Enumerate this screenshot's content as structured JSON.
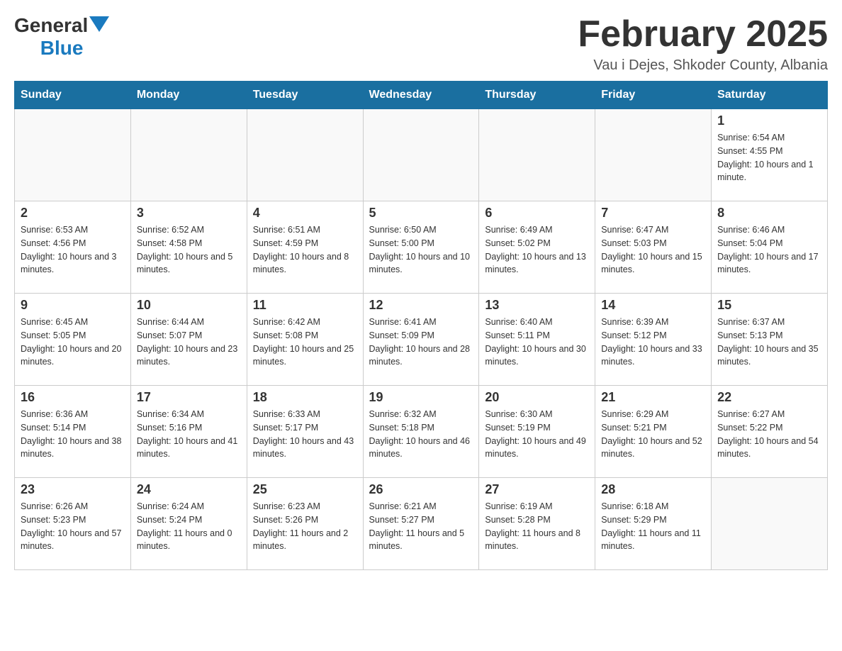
{
  "header": {
    "logo": {
      "general": "General",
      "blue": "Blue"
    },
    "title": "February 2025",
    "location": "Vau i Dejes, Shkoder County, Albania"
  },
  "weekdays": [
    "Sunday",
    "Monday",
    "Tuesday",
    "Wednesday",
    "Thursday",
    "Friday",
    "Saturday"
  ],
  "weeks": [
    [
      {
        "day": "",
        "info": ""
      },
      {
        "day": "",
        "info": ""
      },
      {
        "day": "",
        "info": ""
      },
      {
        "day": "",
        "info": ""
      },
      {
        "day": "",
        "info": ""
      },
      {
        "day": "",
        "info": ""
      },
      {
        "day": "1",
        "info": "Sunrise: 6:54 AM\nSunset: 4:55 PM\nDaylight: 10 hours and 1 minute."
      }
    ],
    [
      {
        "day": "2",
        "info": "Sunrise: 6:53 AM\nSunset: 4:56 PM\nDaylight: 10 hours and 3 minutes."
      },
      {
        "day": "3",
        "info": "Sunrise: 6:52 AM\nSunset: 4:58 PM\nDaylight: 10 hours and 5 minutes."
      },
      {
        "day": "4",
        "info": "Sunrise: 6:51 AM\nSunset: 4:59 PM\nDaylight: 10 hours and 8 minutes."
      },
      {
        "day": "5",
        "info": "Sunrise: 6:50 AM\nSunset: 5:00 PM\nDaylight: 10 hours and 10 minutes."
      },
      {
        "day": "6",
        "info": "Sunrise: 6:49 AM\nSunset: 5:02 PM\nDaylight: 10 hours and 13 minutes."
      },
      {
        "day": "7",
        "info": "Sunrise: 6:47 AM\nSunset: 5:03 PM\nDaylight: 10 hours and 15 minutes."
      },
      {
        "day": "8",
        "info": "Sunrise: 6:46 AM\nSunset: 5:04 PM\nDaylight: 10 hours and 17 minutes."
      }
    ],
    [
      {
        "day": "9",
        "info": "Sunrise: 6:45 AM\nSunset: 5:05 PM\nDaylight: 10 hours and 20 minutes."
      },
      {
        "day": "10",
        "info": "Sunrise: 6:44 AM\nSunset: 5:07 PM\nDaylight: 10 hours and 23 minutes."
      },
      {
        "day": "11",
        "info": "Sunrise: 6:42 AM\nSunset: 5:08 PM\nDaylight: 10 hours and 25 minutes."
      },
      {
        "day": "12",
        "info": "Sunrise: 6:41 AM\nSunset: 5:09 PM\nDaylight: 10 hours and 28 minutes."
      },
      {
        "day": "13",
        "info": "Sunrise: 6:40 AM\nSunset: 5:11 PM\nDaylight: 10 hours and 30 minutes."
      },
      {
        "day": "14",
        "info": "Sunrise: 6:39 AM\nSunset: 5:12 PM\nDaylight: 10 hours and 33 minutes."
      },
      {
        "day": "15",
        "info": "Sunrise: 6:37 AM\nSunset: 5:13 PM\nDaylight: 10 hours and 35 minutes."
      }
    ],
    [
      {
        "day": "16",
        "info": "Sunrise: 6:36 AM\nSunset: 5:14 PM\nDaylight: 10 hours and 38 minutes."
      },
      {
        "day": "17",
        "info": "Sunrise: 6:34 AM\nSunset: 5:16 PM\nDaylight: 10 hours and 41 minutes."
      },
      {
        "day": "18",
        "info": "Sunrise: 6:33 AM\nSunset: 5:17 PM\nDaylight: 10 hours and 43 minutes."
      },
      {
        "day": "19",
        "info": "Sunrise: 6:32 AM\nSunset: 5:18 PM\nDaylight: 10 hours and 46 minutes."
      },
      {
        "day": "20",
        "info": "Sunrise: 6:30 AM\nSunset: 5:19 PM\nDaylight: 10 hours and 49 minutes."
      },
      {
        "day": "21",
        "info": "Sunrise: 6:29 AM\nSunset: 5:21 PM\nDaylight: 10 hours and 52 minutes."
      },
      {
        "day": "22",
        "info": "Sunrise: 6:27 AM\nSunset: 5:22 PM\nDaylight: 10 hours and 54 minutes."
      }
    ],
    [
      {
        "day": "23",
        "info": "Sunrise: 6:26 AM\nSunset: 5:23 PM\nDaylight: 10 hours and 57 minutes."
      },
      {
        "day": "24",
        "info": "Sunrise: 6:24 AM\nSunset: 5:24 PM\nDaylight: 11 hours and 0 minutes."
      },
      {
        "day": "25",
        "info": "Sunrise: 6:23 AM\nSunset: 5:26 PM\nDaylight: 11 hours and 2 minutes."
      },
      {
        "day": "26",
        "info": "Sunrise: 6:21 AM\nSunset: 5:27 PM\nDaylight: 11 hours and 5 minutes."
      },
      {
        "day": "27",
        "info": "Sunrise: 6:19 AM\nSunset: 5:28 PM\nDaylight: 11 hours and 8 minutes."
      },
      {
        "day": "28",
        "info": "Sunrise: 6:18 AM\nSunset: 5:29 PM\nDaylight: 11 hours and 11 minutes."
      },
      {
        "day": "",
        "info": ""
      }
    ]
  ]
}
